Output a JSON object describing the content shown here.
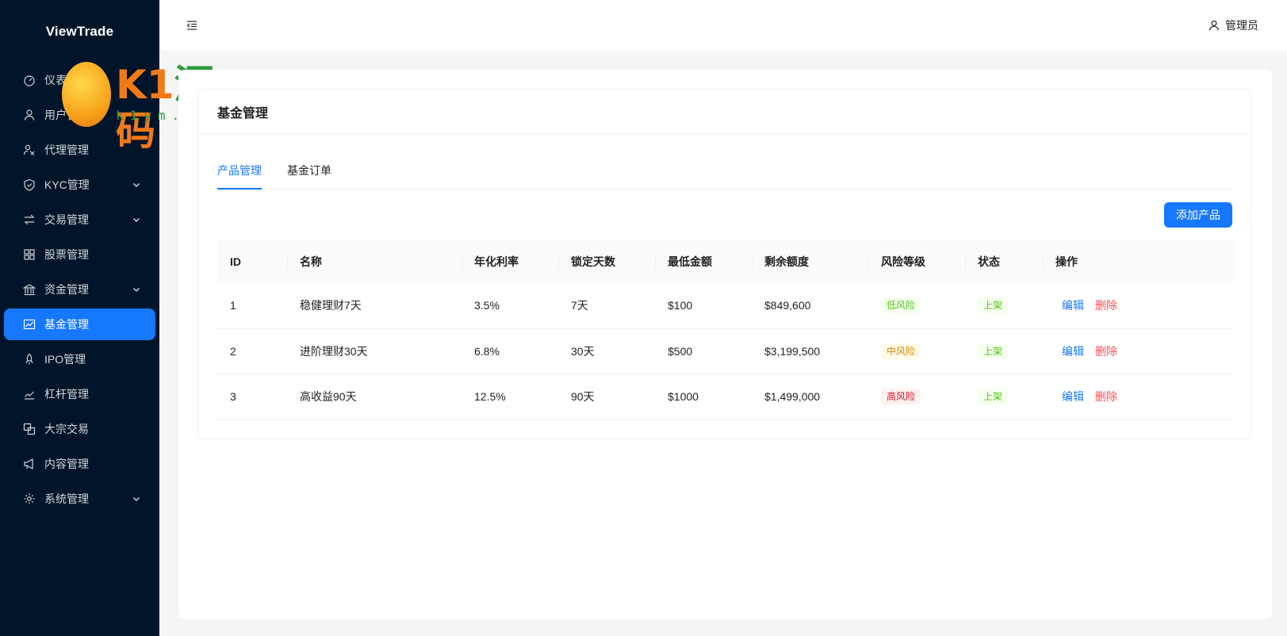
{
  "app": {
    "brand": "ViewTrade"
  },
  "sidebar": {
    "items": [
      {
        "label": "仪表盘",
        "icon": "dashboard-icon",
        "expandable": false,
        "active": false
      },
      {
        "label": "用户管理",
        "icon": "user-icon",
        "expandable": false,
        "active": false
      },
      {
        "label": "代理管理",
        "icon": "agent-icon",
        "expandable": false,
        "active": false
      },
      {
        "label": "KYC管理",
        "icon": "shield-check-icon",
        "expandable": true,
        "active": false
      },
      {
        "label": "交易管理",
        "icon": "swap-icon",
        "expandable": true,
        "active": false
      },
      {
        "label": "股票管理",
        "icon": "grid-icon",
        "expandable": false,
        "active": false
      },
      {
        "label": "资金管理",
        "icon": "bank-icon",
        "expandable": true,
        "active": false
      },
      {
        "label": "基金管理",
        "icon": "fund-chart-icon",
        "expandable": false,
        "active": true
      },
      {
        "label": "IPO管理",
        "icon": "rocket-icon",
        "expandable": false,
        "active": false
      },
      {
        "label": "杠杆管理",
        "icon": "line-chart-icon",
        "expandable": false,
        "active": false
      },
      {
        "label": "大宗交易",
        "icon": "block-icon",
        "expandable": false,
        "active": false
      },
      {
        "label": "内容管理",
        "icon": "megaphone-icon",
        "expandable": false,
        "active": false
      },
      {
        "label": "系统管理",
        "icon": "gear-icon",
        "expandable": true,
        "active": false
      }
    ]
  },
  "watermark": {
    "main": "K1",
    "main_accent": "源",
    "main_tail": "码",
    "sub": "k1ym.com"
  },
  "header": {
    "user_label": "管理员"
  },
  "page": {
    "card_title": "基金管理",
    "tabs": [
      {
        "label": "产品管理",
        "active": true
      },
      {
        "label": "基金订单",
        "active": false
      }
    ],
    "add_button": "添加产品"
  },
  "table": {
    "columns": [
      "ID",
      "名称",
      "年化利率",
      "锁定天数",
      "最低金额",
      "剩余额度",
      "风险等级",
      "状态",
      "操作"
    ],
    "rows": [
      {
        "id": "1",
        "name": "稳健理财7天",
        "rate": "3.5%",
        "days": "7天",
        "min": "$100",
        "remaining": "$849,600",
        "risk": "低风险",
        "risk_level": "low",
        "status": "上架",
        "edit": "编辑",
        "delete": "删除"
      },
      {
        "id": "2",
        "name": "进阶理财30天",
        "rate": "6.8%",
        "days": "30天",
        "min": "$500",
        "remaining": "$3,199,500",
        "risk": "中风险",
        "risk_level": "mid",
        "status": "上架",
        "edit": "编辑",
        "delete": "删除"
      },
      {
        "id": "3",
        "name": "高收益90天",
        "rate": "12.5%",
        "days": "90天",
        "min": "$1000",
        "remaining": "$1,499,000",
        "risk": "高风险",
        "risk_level": "high",
        "status": "上架",
        "edit": "编辑",
        "delete": "删除"
      }
    ]
  },
  "colors": {
    "sidebar_bg": "#001529",
    "accent": "#1677ff",
    "danger": "#ff4d4f"
  }
}
